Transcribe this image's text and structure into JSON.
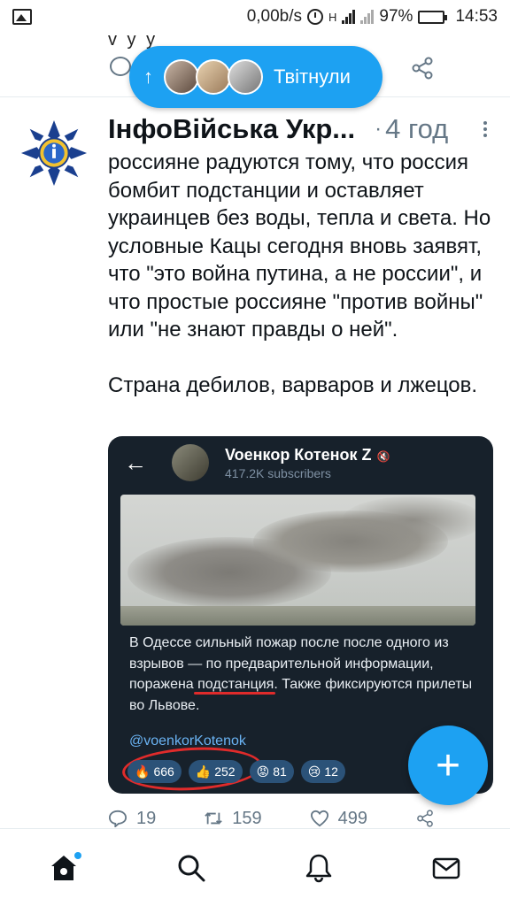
{
  "status_bar": {
    "network_speed": "0,00b/s",
    "network_type": "H",
    "battery_percent": "97%",
    "time": "14:53",
    "battery_color": "#1db954"
  },
  "prev_tweet": {
    "cut_text": "v y y"
  },
  "retweet_pill": {
    "label": "Твітнули",
    "arrow": "↑",
    "color": "#1da1f2"
  },
  "tweet": {
    "author": "ІнфоВійська Укр...",
    "separator": "·",
    "time": "4 год",
    "paragraphs": [
      "россияне радуются тому, что россия бомбит подстанции и оставляет украинцев без воды, тепла и света. Но условные Кацы сегодня вновь заявят, что \"это война путина, а не россии\", и что простые россияне \"против войны\" или \"не знают правды о ней\".",
      "Страна дебилов, варваров и лжецов."
    ],
    "embed": {
      "channel_name": "Voенкор Котенок Z",
      "subscribers": "417.2K subscribers",
      "message_before": "В Одессе сильный пожар после после одного из взрывов — по предварительной информации, поражена ",
      "message_underlined": "подстанция",
      "message_after": ". Также фиксируются прилеты во Львове.",
      "handle": "@voenkorKotenok",
      "reactions": [
        {
          "emoji": "🔥",
          "count": "666"
        },
        {
          "emoji": "👍",
          "count": "252"
        },
        {
          "emoji": "😡",
          "count": "81"
        },
        {
          "emoji": "😢",
          "count": "12"
        }
      ]
    },
    "actions": {
      "replies": "19",
      "retweets": "159",
      "likes": "499"
    }
  },
  "fab": {
    "label": "+"
  },
  "bottom_nav": {
    "items": [
      "home-icon",
      "search-icon",
      "notifications-icon",
      "messages-icon"
    ]
  }
}
